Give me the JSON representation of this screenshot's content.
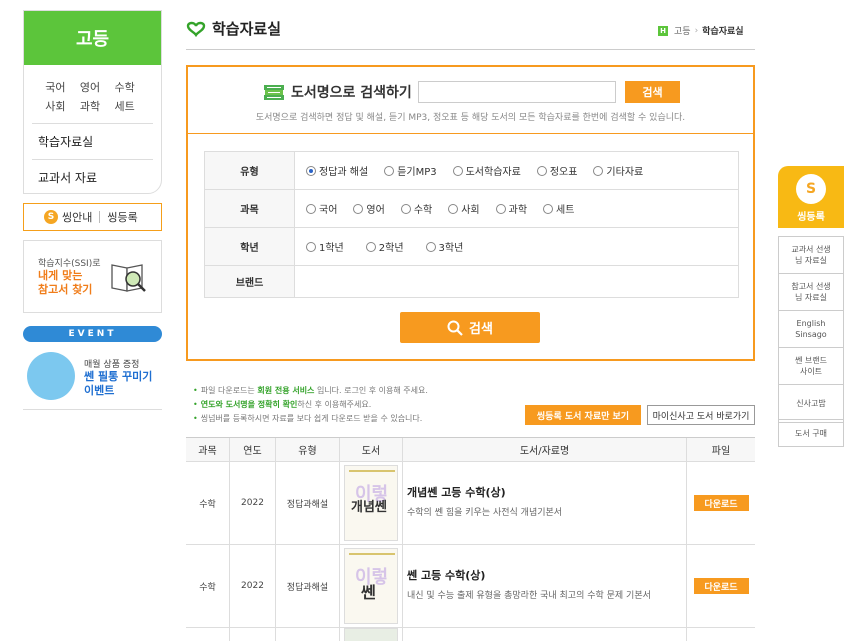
{
  "sidebar": {
    "heading": "고등",
    "subjects": [
      "국어",
      "영어",
      "수학",
      "사회",
      "과학",
      "세트"
    ],
    "menu": [
      "학습자료실",
      "교과서 자료"
    ],
    "ssi_guide": "씽안내",
    "ssi_register": "씽등록",
    "ssi_badge": "S",
    "ssi_box_line1": "학습지수(SSI)로",
    "ssi_box_line2": "내게 맞는",
    "ssi_box_line3": "참고서 찾기",
    "event_label": "EVENT",
    "event_line1": "매월 상품 증정",
    "event_line2": "쎈 필통 꾸미기",
    "event_line3": "이벤트"
  },
  "header": {
    "title": "학습자료실",
    "crumb_home": "H",
    "crumb_1": "고등",
    "crumb_2": "학습자료실"
  },
  "book_search": {
    "label": "도서명으로 검색하기",
    "input_value": "",
    "button": "검색",
    "description": "도서명으로 검색하면 정답 및 해설, 듣기 MP3, 정오표 등 해당 도서의 모든 학습자료를 한번에 검색할 수 있습니다."
  },
  "filters": {
    "type_label": "유형",
    "type_options": [
      "정답과 해설",
      "듣기MP3",
      "도서학습자료",
      "정오표",
      "기타자료"
    ],
    "subject_label": "과목",
    "subject_options": [
      "국어",
      "영어",
      "수학",
      "사회",
      "과학",
      "세트"
    ],
    "grade_label": "학년",
    "grade_options": [
      "1학년",
      "2학년",
      "3학년"
    ],
    "brand_label": "브랜드",
    "search_button": "검색"
  },
  "notes": {
    "line1_pre": "파일 다운로드는 ",
    "line1_hl": "회원 전용 서비스",
    "line1_post": " 입니다. 로그인 후 이용해 주세요.",
    "line2_hl": "연도와 도서명을 정확히 확인",
    "line2_post": "하신 후 이용해주세요.",
    "line3": "씽넘버를 등록하시면 자료를 보다 쉽게 다운로드 받을 수 있습니다.",
    "btn_registered": "씽등록 도서 자료만 보기",
    "btn_mybooks": "마이신사고 도서 바로가기"
  },
  "results": {
    "headers": [
      "과목",
      "연도",
      "유형",
      "도서",
      "도서/자료명",
      "파일"
    ],
    "rows": [
      {
        "subject": "수학",
        "year": "2022",
        "type": "정답과해설",
        "title": "개념쎈 고등 수학(상)",
        "desc": "수학의 쎈 힘을 키우는 사전식 개념기본서",
        "file": "다운로드",
        "cover_text1": "이렇",
        "cover_text2": "개념쎈"
      },
      {
        "subject": "수학",
        "year": "2022",
        "type": "정답과해설",
        "title": "쎈 고등 수학(상)",
        "desc": "내신 및 수능 출제 유형을 총망라한 국내 최고의 수학 문제 기본서",
        "file": "다운로드",
        "cover_text1": "이렇",
        "cover_text2": "쎈"
      }
    ]
  },
  "quick_menu": {
    "badge": "S",
    "register": "씽등록",
    "items": [
      "교과서 선생님 자료실",
      "참고서 선생님 자료실",
      "English Sinsago",
      "쎈 브랜드 사이트",
      "신사고밥"
    ],
    "last": "도서 구매"
  },
  "colors": {
    "brand_green": "#5cc53b",
    "accent_orange": "#f79a1f",
    "quick_yellow": "#f8b914",
    "event_blue": "#2f8ad6"
  }
}
